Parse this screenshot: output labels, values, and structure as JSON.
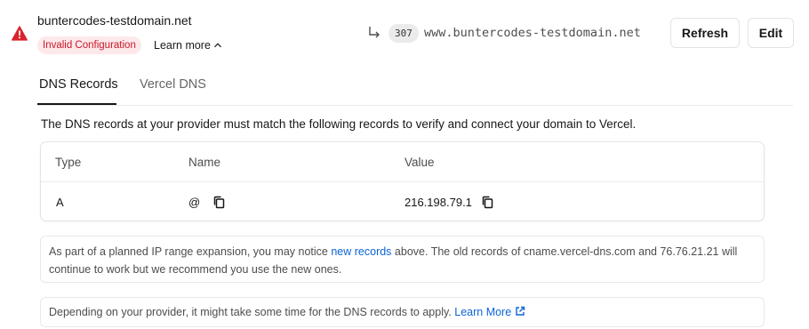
{
  "domain": {
    "name": "buntercodes-testdomain.net",
    "status_badge": "Invalid Configuration",
    "learn_more": "Learn more",
    "redirect_code": "307",
    "redirect_target": "www.buntercodes-testdomain.net"
  },
  "actions": {
    "refresh_label": "Refresh",
    "edit_label": "Edit"
  },
  "tabs": [
    {
      "label": "DNS Records",
      "active": true
    },
    {
      "label": "Vercel DNS",
      "active": false
    }
  ],
  "intro_text": "The DNS records at your provider must match the following records to verify and connect your domain to Vercel.",
  "records_table": {
    "headers": [
      "Type",
      "Name",
      "Value"
    ],
    "rows": [
      {
        "type": "A",
        "name": "@",
        "value": "216.198.79.1"
      }
    ]
  },
  "notes": {
    "expansion_before": "As part of a planned IP range expansion, you may notice ",
    "expansion_link": "new records",
    "expansion_after": " above. The old records of cname.vercel-dns.com and 76.76.21.21 will continue to work but we recommend you use the new ones.",
    "propagation_before": "Depending on your provider, it might take some time for the DNS records to apply. ",
    "propagation_link": "Learn More"
  },
  "colors": {
    "error": "#c9182b",
    "error_bg": "#fde8ea",
    "link": "#0a64d6",
    "text": "#171717",
    "muted": "#4d4d4d"
  },
  "icons": [
    "warning-icon",
    "chevron-up-icon",
    "redirect-arrow-icon",
    "copy-icon",
    "external-link-icon"
  ]
}
